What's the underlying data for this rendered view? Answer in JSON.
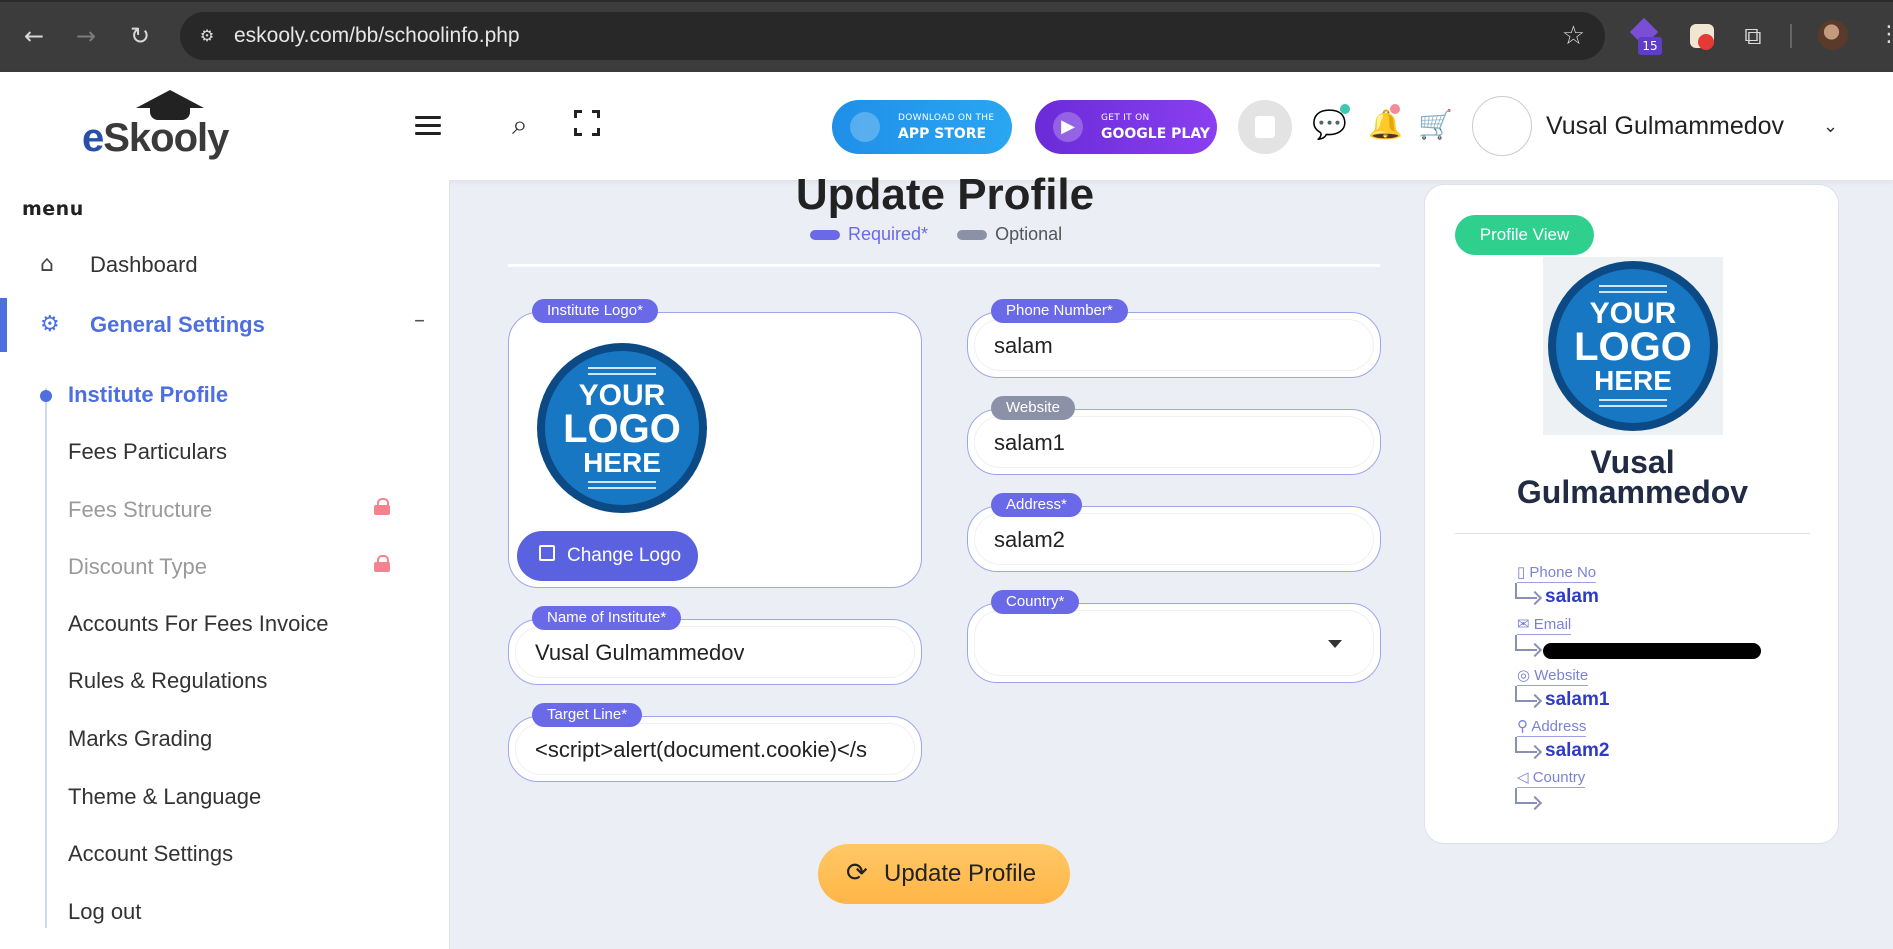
{
  "browser": {
    "url": "eskooly.com/bb/schoolinfo.php",
    "extension_badge": "15"
  },
  "header": {
    "logo_text_e": "e",
    "logo_text_rest": "Skooly",
    "appstore_small": "DOWNLOAD ON THE",
    "appstore_big": "APP STORE",
    "googleplay_small": "GET IT ON",
    "googleplay_big": "GOOGLE PLAY",
    "user_name": "Vusal Gulmammedov"
  },
  "sidebar": {
    "title": "menu",
    "items": [
      {
        "label": "Dashboard",
        "icon": "home-icon"
      },
      {
        "label": "General Settings",
        "icon": "gear-icon",
        "toggle": "–"
      }
    ],
    "sub_items": [
      {
        "label": "Institute Profile"
      },
      {
        "label": "Fees Particulars"
      },
      {
        "label": "Fees Structure"
      },
      {
        "label": "Discount Type"
      },
      {
        "label": "Accounts For Fees Invoice"
      },
      {
        "label": "Rules & Regulations"
      },
      {
        "label": "Marks Grading"
      },
      {
        "label": "Theme & Language"
      },
      {
        "label": "Account Settings"
      },
      {
        "label": "Log out"
      }
    ]
  },
  "main": {
    "title": "Update Profile",
    "legend_required": "Required*",
    "legend_optional": "Optional",
    "fields": {
      "institute_logo": {
        "label": "Institute Logo*"
      },
      "phone": {
        "label": "Phone Number*",
        "value": "salam"
      },
      "website": {
        "label": "Website",
        "value": "salam1"
      },
      "address": {
        "label": "Address*",
        "value": "salam2"
      },
      "country": {
        "label": "Country*",
        "value": ""
      },
      "name": {
        "label": "Name of Institute*",
        "value": "Vusal Gulmammedov"
      },
      "target_line": {
        "label": "Target Line*",
        "value": "<script>alert(document.cookie)</s"
      }
    },
    "change_logo_label": "Change Logo",
    "update_button_label": "Update Profile",
    "logo_placeholder": {
      "line1": "YOUR",
      "line2": "LOGO",
      "line3": "HERE"
    }
  },
  "profile_card": {
    "view_button": "Profile View",
    "name_line1": "Vusal",
    "name_line2": "Gulmammedov",
    "info": [
      {
        "label": "Phone No",
        "value": "salam"
      },
      {
        "label": "Email",
        "value": ""
      },
      {
        "label": "Website",
        "value": "salam1"
      },
      {
        "label": "Address",
        "value": "salam2"
      },
      {
        "label": "Country",
        "value": ""
      }
    ]
  },
  "colors": {
    "accent": "#4d6fe0",
    "required_pill": "#6a6ae8",
    "optional_pill": "#8b92a8",
    "profile_view": "#2fcf8e",
    "update_button": "#ffb547"
  }
}
